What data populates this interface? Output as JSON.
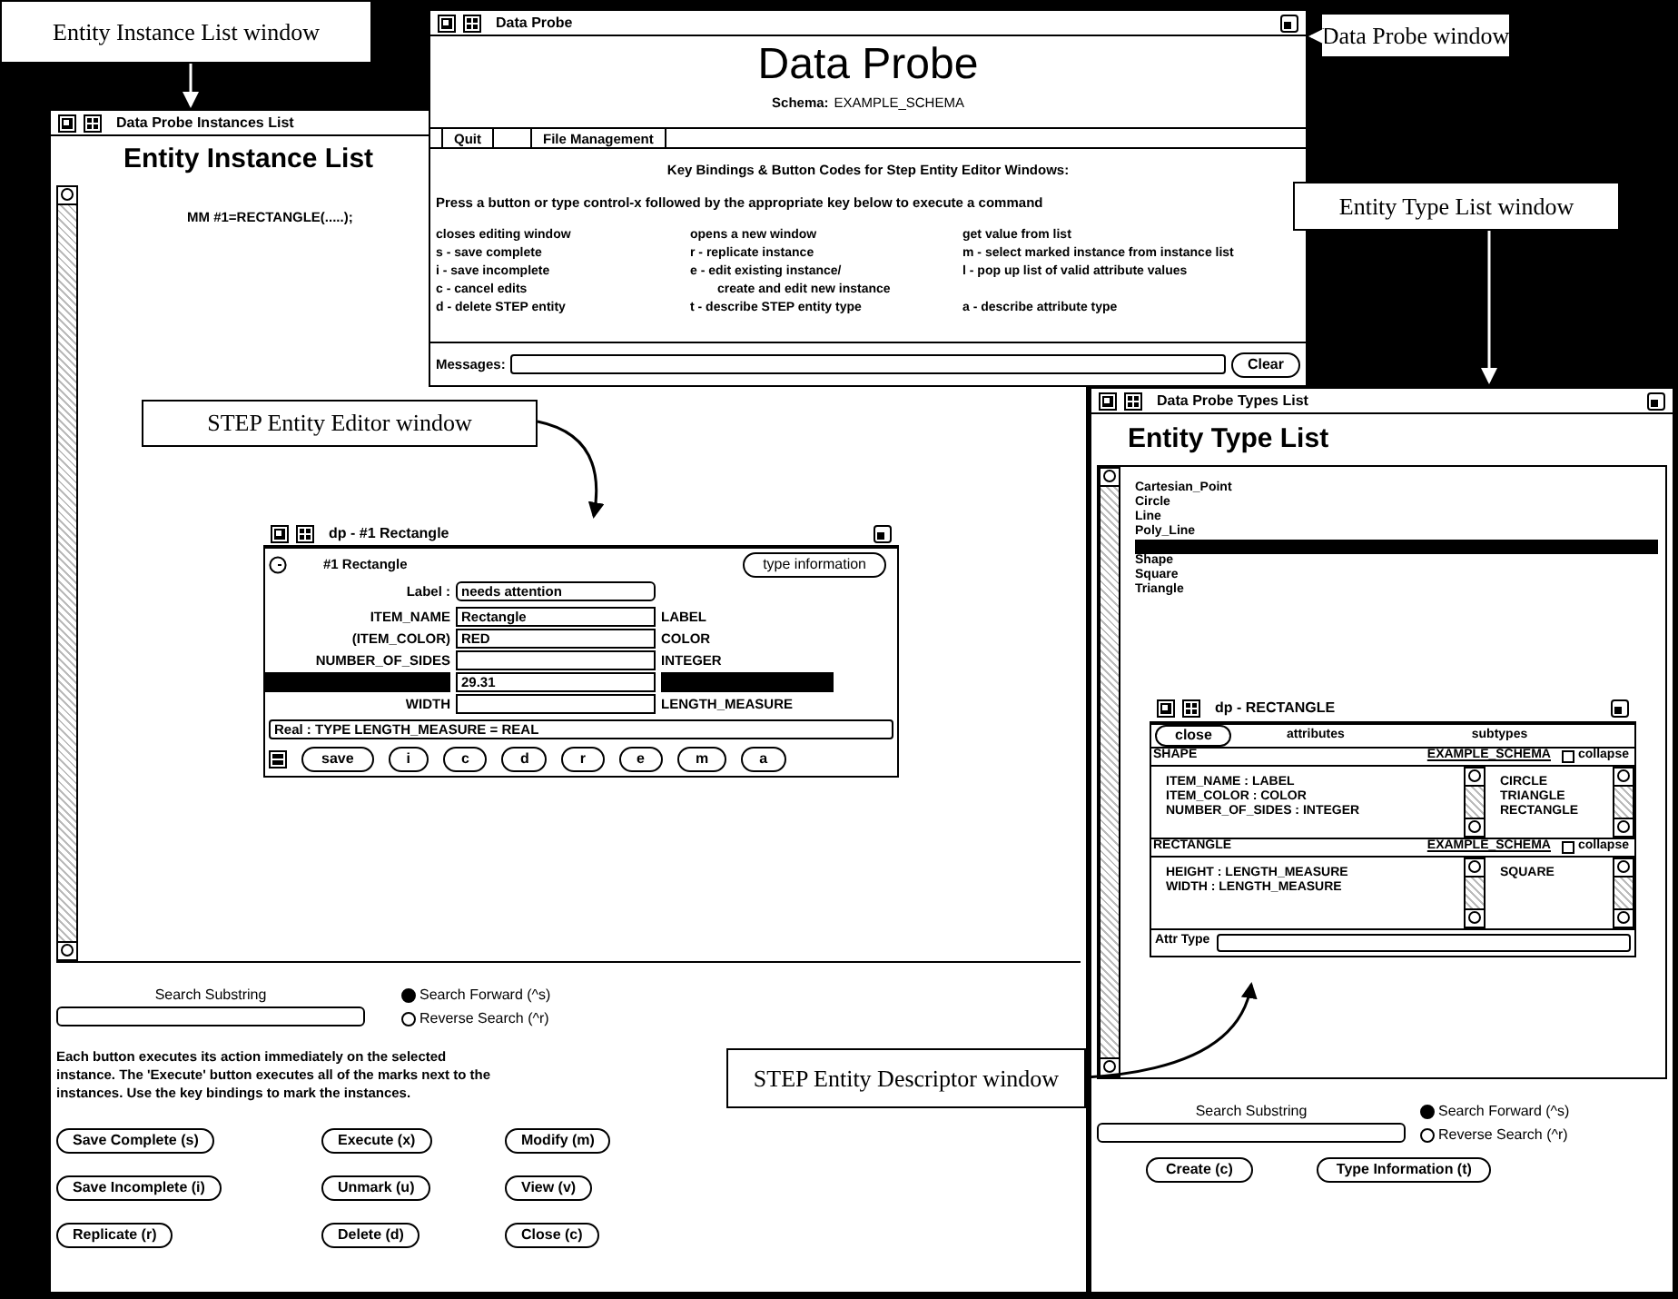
{
  "callouts": [
    {
      "text": "Entity Instance List window"
    },
    {
      "text": "Data Probe window"
    },
    {
      "text": "Entity Type List window"
    },
    {
      "text": "STEP Entity Editor window"
    },
    {
      "text": "STEP Entity Descriptor window"
    }
  ],
  "instance_list": {
    "title": "Data Probe Instances List",
    "heading": "Entity Instance List",
    "rows": [
      "MM #1=RECTANGLE(.....);"
    ],
    "search_label": "Search Substring",
    "radios": [
      {
        "label": "Search Forward (^s)",
        "selected": true
      },
      {
        "label": "Reverse Search (^r)",
        "selected": false
      }
    ],
    "description": "Each button executes its action immediately on the selected instance. The 'Execute' button executes all of the marks next to the instances. Use the key bindings to mark the instances.",
    "buttons": [
      "Save Complete (s)",
      "Execute (x)",
      "Modify (m)",
      "Save Incomplete (i)",
      "Unmark (u)",
      "View (v)",
      "Replicate (r)",
      "Delete (d)",
      "Close (c)"
    ]
  },
  "data_probe": {
    "title": "Data Probe",
    "heading": "Data Probe",
    "schema_label": "Schema:",
    "schema": "EXAMPLE_SCHEMA",
    "menu": [
      "Quit",
      "File Management"
    ],
    "bindings_title": "Key Bindings & Button Codes for Step Entity Editor Windows:",
    "bindings_intro": "Press a button or type control-x followed by the appropriate key below to execute a command",
    "binding_columns": [
      [
        "closes editing window",
        "s - save complete",
        "i - save incomplete",
        "c - cancel edits",
        "d - delete STEP entity"
      ],
      [
        "opens a new window",
        "r - replicate instance",
        "e - edit existing instance/",
        "create and edit new instance",
        "t - describe STEP entity type"
      ],
      [
        "get value from list",
        "m - select marked instance from instance list",
        "l - pop up list of valid attribute values",
        "",
        "a - describe attribute type"
      ]
    ],
    "messages_label": "Messages:",
    "clear_button": "Clear"
  },
  "editor": {
    "title": "dp - #1 Rectangle",
    "heading": "#1 Rectangle",
    "type_button": "type information",
    "label_caption": "Label :",
    "label_value": "needs attention",
    "rows": [
      {
        "name": "ITEM_NAME",
        "value": "Rectangle",
        "type": "LABEL",
        "selected": false
      },
      {
        "name": "(ITEM_COLOR)",
        "value": "RED",
        "type": "COLOR",
        "selected": false
      },
      {
        "name": "NUMBER_OF_SIDES",
        "type": "INTEGER",
        "selected": false
      },
      {
        "value": "29.31",
        "selected": true
      },
      {
        "name": "WIDTH",
        "type": "LENGTH_MEASURE",
        "selected": false
      }
    ],
    "status": "Real : TYPE LENGTH_MEASURE = REAL",
    "buttons": [
      "save",
      "i",
      "c",
      "d",
      "r",
      "e",
      "m",
      "a"
    ]
  },
  "type_list": {
    "title": "Data Probe Types List",
    "heading": "Entity Type List",
    "items": [
      {
        "label": "Cartesian_Point",
        "selected": false
      },
      {
        "label": "Circle",
        "selected": false
      },
      {
        "label": "Line",
        "selected": false
      },
      {
        "label": "Poly_Line",
        "selected": false
      },
      {
        "selected": true
      },
      {
        "label": "Shape",
        "selected": false
      },
      {
        "label": "Square",
        "selected": false
      },
      {
        "label": "Triangle",
        "selected": false
      }
    ],
    "search_label": "Search Substring",
    "radios": [
      {
        "label": "Search Forward (^s)",
        "selected": true
      },
      {
        "label": "Reverse Search (^r)",
        "selected": false
      }
    ],
    "buttons": [
      "Create (c)",
      "Type Information (t)"
    ]
  },
  "descriptor": {
    "title": "dp - RECTANGLE",
    "tabs": [
      "close",
      "attributes",
      "subtypes"
    ],
    "sections": [
      {
        "name": "SHAPE",
        "schema": "EXAMPLE_SCHEMA",
        "collapse_label": "collapse",
        "collapsed": false,
        "attributes": [
          "ITEM_NAME : LABEL",
          "ITEM_COLOR : COLOR",
          "NUMBER_OF_SIDES : INTEGER"
        ],
        "subtypes": [
          "CIRCLE",
          "TRIANGLE",
          "RECTANGLE"
        ]
      },
      {
        "name": "RECTANGLE",
        "schema": "EXAMPLE_SCHEMA",
        "collapse_label": "collapse",
        "collapsed": false,
        "attributes": [
          "HEIGHT : LENGTH_MEASURE",
          "WIDTH : LENGTH_MEASURE"
        ],
        "subtypes": [
          "SQUARE"
        ]
      }
    ],
    "attr_label": "Attr Type"
  }
}
